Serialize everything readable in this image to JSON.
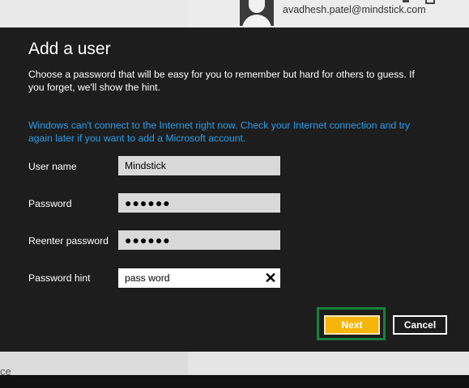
{
  "account": {
    "email": "avadhesh.patel@mindstick.com"
  },
  "dialog": {
    "title": "Add a user",
    "description": "Choose a password that will be easy for you to remember but hard for others to guess. If you forget, we'll show the hint.",
    "warning": "Windows can't connect to the Internet right now. Check your Internet connection and try again later if you want to add a Microsoft account."
  },
  "form": {
    "username": {
      "label": "User name",
      "value": "Mindstick"
    },
    "password": {
      "label": "Password",
      "value": "●●●●●●"
    },
    "reenter": {
      "label": "Reenter password",
      "value": "●●●●●●"
    },
    "hint": {
      "label": "Password hint",
      "value": "pass word",
      "clear_glyph": "✕"
    }
  },
  "buttons": {
    "next": "Next",
    "cancel": "Cancel"
  },
  "background": {
    "bottom_fragment": "ce"
  },
  "colors": {
    "accent_link": "#2f9ce6",
    "next_button": "#f5b50a",
    "focus_outline": "#17823b"
  }
}
